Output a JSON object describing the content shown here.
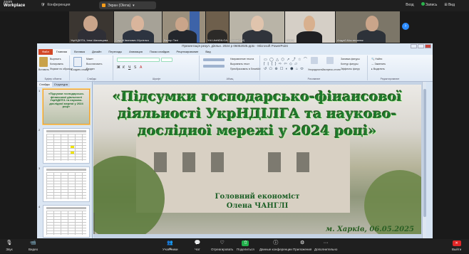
{
  "zoom": {
    "brand_top": "zoom",
    "brand_bottom": "Workplace",
    "meeting_label": "Конференция",
    "share_title": "Экран (Olena)",
    "top_right": {
      "login": "Вход",
      "record": "Запись",
      "view": "Вид"
    },
    "participants": [
      {
        "name": "УкрНДІЛГА, Інна Шаховцова"
      },
      {
        "name": "Сергій Іванович Мусієнко"
      },
      {
        "name": "Віктор Тихі"
      },
      {
        "name": "Yrii UkrNDILGA"
      },
      {
        "name": "Уський (И)"
      },
      {
        "name": "Olena"
      },
      {
        "name": "Андрій Мостепанюк"
      }
    ],
    "bottom_toolbar": {
      "audio": "Звук",
      "video": "Видео",
      "participants": "Участники",
      "participants_count": "41",
      "chat": "Чат",
      "react": "Отреагировать",
      "share": "Поделиться",
      "host_tools": "Данные конференции",
      "apps": "Приложения",
      "more": "Дополнительно",
      "leave": "Выйти"
    }
  },
  "powerpoint": {
    "window_title": "Презентація резул. діяльн. 2024 р 06052025.pptx  -  Microsoft PowerPoint",
    "tabs": [
      "Файл",
      "Главная",
      "Вставка",
      "Дизайн",
      "Переходы",
      "Анимация",
      "Показ слайдов",
      "Рецензирование",
      "Вид"
    ],
    "ribbon": {
      "clipboard": {
        "paste": "Вставить",
        "cut": "Вырезать",
        "copy": "Копировать",
        "format": "Формат по образцу",
        "group": "Буфер обмена"
      },
      "slides": {
        "new_slide": "Создать слайд",
        "layout": "Макет",
        "reset": "Восстановить",
        "section": "Раздел",
        "group": "Слайды"
      },
      "font": {
        "group": "Шрифт"
      },
      "paragraph": {
        "text_dir": "Направление текста",
        "align": "Выровнять текст",
        "smartart": "Преобразовать в SmartArt",
        "group": "Абзац"
      },
      "drawing": {
        "arrange": "Упорядочить",
        "styles": "Экспресс-стили",
        "fill": "Заливка фигуры",
        "outline": "Контур фигуры",
        "effects": "Эффекты фигур",
        "group": "Рисование"
      },
      "editing": {
        "find": "Найти",
        "replace": "Заменить",
        "select": "Выделить",
        "group": "Редактирование"
      }
    },
    "pane_tabs": [
      "Слайды",
      "Структура"
    ],
    "thumbnails": [
      {
        "num": "1",
        "text": "«Підсумки господарсько-фінансової діяльності УкрНДІЛГА та науково-дослідної мережі у 2024 році»"
      },
      {
        "num": "2"
      },
      {
        "num": "3"
      },
      {
        "num": "4"
      }
    ],
    "slide": {
      "title": "«Підсумки господарсько-фінансової діяльності УкрНДІЛГА та науково-дослідної мережі у 2024 році»",
      "position": "Головний економіст",
      "person": "Олена ЧАНГЛІ",
      "footer": "м. Харків, 06.05.2025"
    }
  }
}
